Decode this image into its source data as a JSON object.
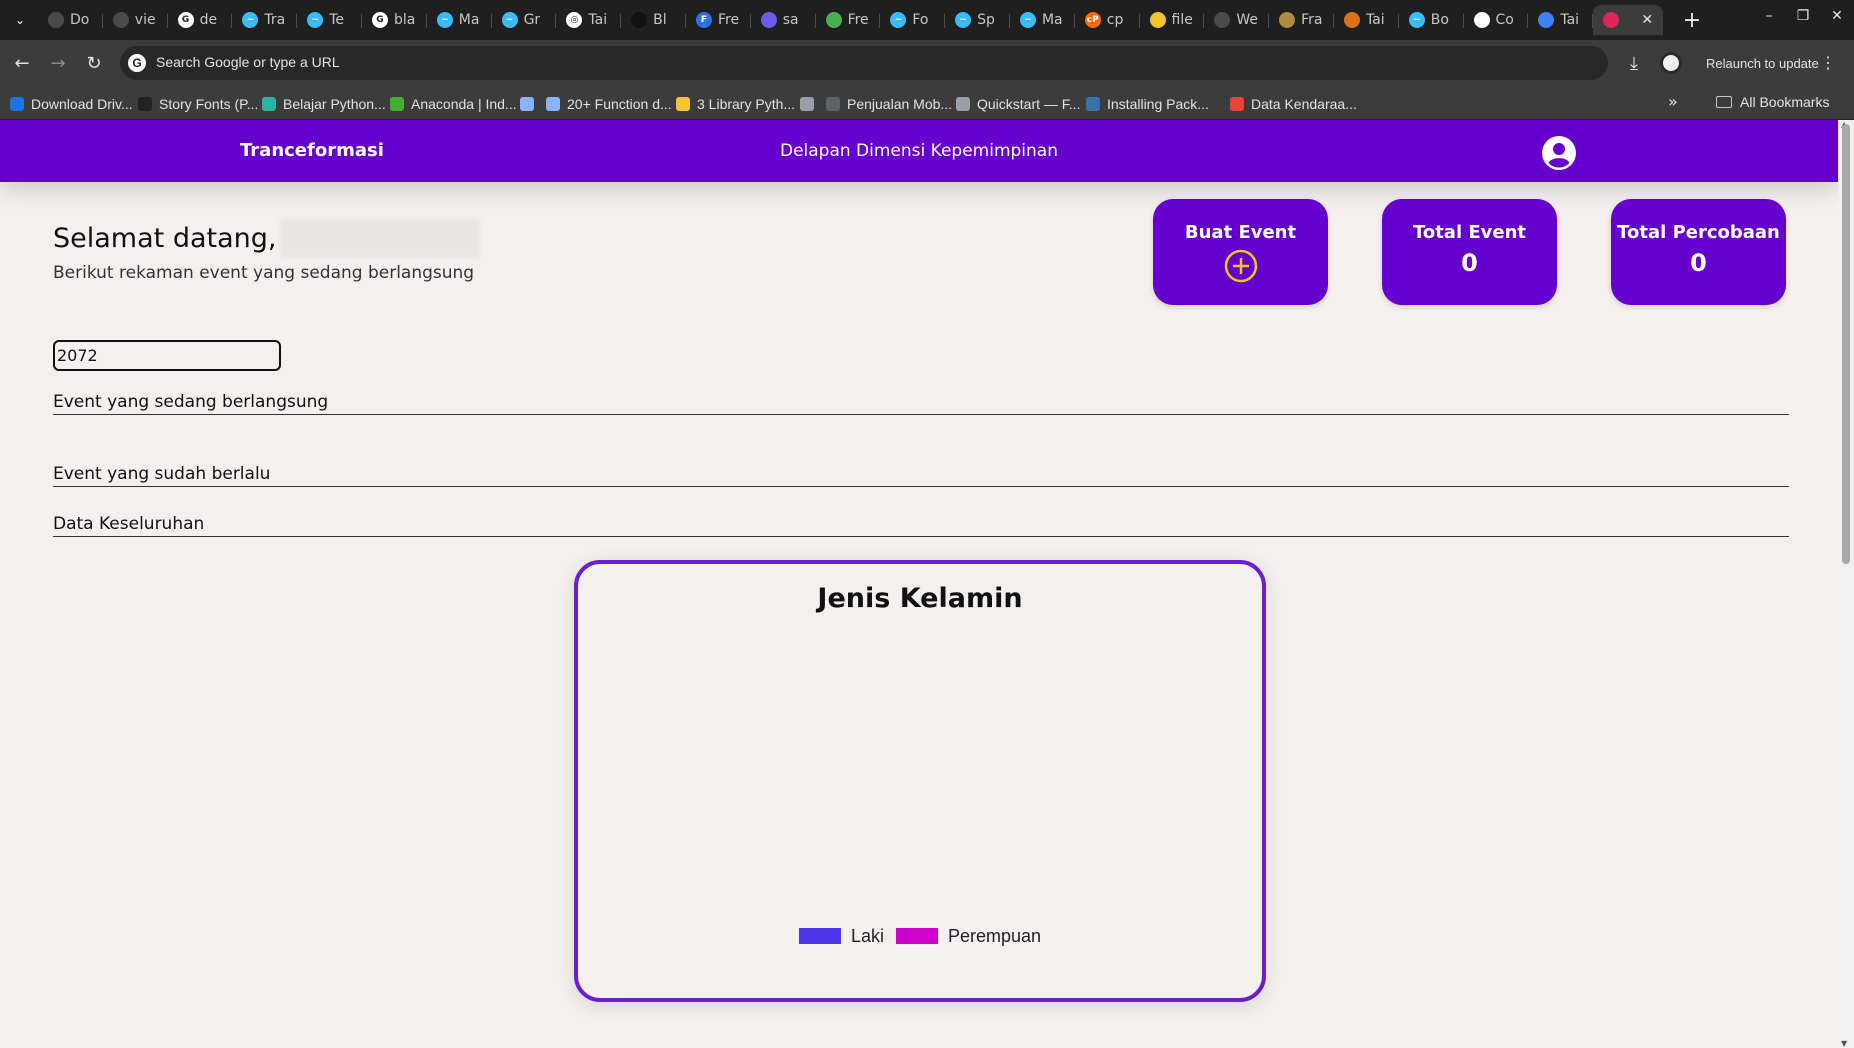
{
  "browser": {
    "tabs": [
      {
        "label": "Do",
        "color": "#4a4a4a",
        "glyph": ""
      },
      {
        "label": "vie",
        "color": "#4a4a4a",
        "glyph": ""
      },
      {
        "label": "de",
        "color": "#ffffff",
        "glyph": "G"
      },
      {
        "label": "Tra",
        "color": "#38bdf8",
        "glyph": "~"
      },
      {
        "label": "Te",
        "color": "#38bdf8",
        "glyph": "~"
      },
      {
        "label": "bla",
        "color": "#ffffff",
        "glyph": "G"
      },
      {
        "label": "Ma",
        "color": "#38bdf8",
        "glyph": "~"
      },
      {
        "label": "Gr",
        "color": "#38bdf8",
        "glyph": "~"
      },
      {
        "label": "Tai",
        "color": "#ffffff",
        "glyph": "◎"
      },
      {
        "label": "Bl",
        "color": "#111111",
        "glyph": ""
      },
      {
        "label": "Fre",
        "color": "#2f6fe4",
        "glyph": "F"
      },
      {
        "label": "sa",
        "color": "#6d5ce8",
        "glyph": ""
      },
      {
        "label": "Fre",
        "color": "#4caf50",
        "glyph": ""
      },
      {
        "label": "Fo",
        "color": "#38bdf8",
        "glyph": "~"
      },
      {
        "label": "Sp",
        "color": "#38bdf8",
        "glyph": "~"
      },
      {
        "label": "Ma",
        "color": "#38bdf8",
        "glyph": "~"
      },
      {
        "label": "cp",
        "color": "#ff6a00",
        "glyph": "cP"
      },
      {
        "label": "file",
        "color": "#f4c430",
        "glyph": ""
      },
      {
        "label": "We",
        "color": "#4a4a4a",
        "glyph": ""
      },
      {
        "label": "Fra",
        "color": "#b08a3e",
        "glyph": ""
      },
      {
        "label": "Tai",
        "color": "#d9731a",
        "glyph": ""
      },
      {
        "label": "Bo",
        "color": "#38bdf8",
        "glyph": "~"
      },
      {
        "label": "Co",
        "color": "#ffffff",
        "glyph": ""
      },
      {
        "label": "Tai",
        "color": "#3b82f6",
        "glyph": ""
      }
    ],
    "active_tab_close": "✕",
    "new_tab": "+",
    "omnibox_placeholder": "Search Google or type a URL",
    "relaunch_label": "Relaunch to update",
    "bookmarks": [
      {
        "label": "Download Driv...",
        "color": "#1a73e8"
      },
      {
        "label": "Story Fonts (P...",
        "color": "#222222"
      },
      {
        "label": "Belajar Python...",
        "color": "#2bb3a3"
      },
      {
        "label": "Anaconda | Ind...",
        "color": "#43b02a"
      },
      {
        "label": "",
        "color": "#8ab4f8"
      },
      {
        "label": "20+ Function d...",
        "color": "#8ab4f8"
      },
      {
        "label": "3 Library Pyth...",
        "color": "#f4c430"
      },
      {
        "label": "",
        "color": "#9aa0a6"
      },
      {
        "label": "Penjualan Mob...",
        "color": "#5f6368"
      },
      {
        "label": "Quickstart — F...",
        "color": "#9aa0a6"
      },
      {
        "label": "Installing Pack...",
        "color": "#3776ab"
      },
      {
        "label": "Data Kendaraa...",
        "color": "#ea4335"
      }
    ],
    "more_bookmarks": "»",
    "all_bookmarks_label": "All Bookmarks"
  },
  "app": {
    "brand": "Tranceformasi",
    "nav_center": "Delapan Dimensi Kepemimpinan",
    "welcome_prefix": "Selamat datang,",
    "subtitle": "Berikut rekaman event yang sedang berlangsung",
    "cards": {
      "create_label": "Buat Event",
      "total_event_label": "Total Event",
      "total_event_value": "0",
      "total_trial_label": "Total Percobaan",
      "total_trial_value": "0"
    },
    "year_value": "2072",
    "sections": {
      "ongoing": "Event yang sedang berlangsung",
      "past": "Event yang sudah berlalu",
      "overall": "Data Keseluruhan"
    }
  },
  "chart_data": {
    "type": "pie",
    "title": "Jenis Kelamin",
    "series": [
      {
        "name": "Laki",
        "value": 0,
        "color": "#4f35e8"
      },
      {
        "name": "Perempuan",
        "value": 0,
        "color": "#cc00cc"
      }
    ],
    "legend_position": "bottom"
  }
}
